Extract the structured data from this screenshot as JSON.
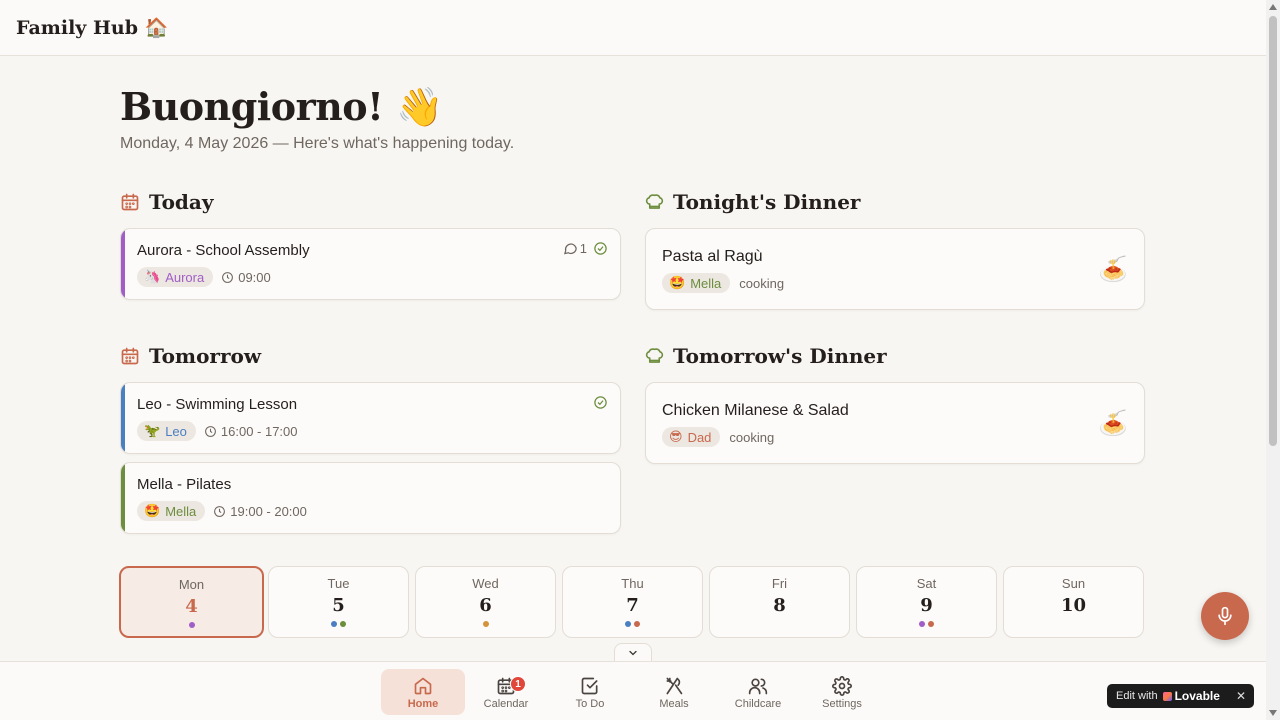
{
  "app": {
    "title": "Family Hub",
    "title_emoji": "🏠"
  },
  "greeting": {
    "text": "Buongiorno!",
    "emoji": "👋",
    "subtitle": "Monday, 4 May 2026 — Here's what's happening today."
  },
  "today": {
    "title": "Today",
    "events": [
      {
        "title": "Aurora - School Assembly",
        "person": "Aurora",
        "person_emoji": "🦄",
        "time": "09:00",
        "comments": "1",
        "color": "#a15ec6",
        "chip_color": "#a15ec6"
      }
    ]
  },
  "tomorrow": {
    "title": "Tomorrow",
    "events": [
      {
        "title": "Leo - Swimming Lesson",
        "person": "Leo",
        "person_emoji": "🦖",
        "time": "16:00 - 17:00",
        "color": "#4a7fc1",
        "chip_color": "#4a7fc1"
      },
      {
        "title": "Mella - Pilates",
        "person": "Mella",
        "person_emoji": "🤩",
        "time": "19:00 - 20:00",
        "color": "#6d8d3f",
        "chip_color": "#6d8d3f"
      }
    ]
  },
  "tonight_dinner": {
    "title": "Tonight's Dinner",
    "dish": "Pasta al Ragù",
    "cook": "Mella",
    "cook_emoji": "🤩",
    "role": "cooking",
    "dish_emoji": "🍝",
    "chip_color": "#6d8d3f"
  },
  "tomorrow_dinner": {
    "title": "Tomorrow's Dinner",
    "dish": "Chicken Milanese & Salad",
    "cook": "Dad",
    "cook_emoji": "😎",
    "role": "cooking",
    "dish_emoji": "🍝",
    "chip_color": "#c8694e"
  },
  "week": [
    {
      "name": "Mon",
      "num": "4",
      "dots": [
        "#a15ec6"
      ]
    },
    {
      "name": "Tue",
      "num": "5",
      "dots": [
        "#4a7fc1",
        "#6d8d3f"
      ]
    },
    {
      "name": "Wed",
      "num": "6",
      "dots": [
        "#d4933a"
      ]
    },
    {
      "name": "Thu",
      "num": "7",
      "dots": [
        "#4a7fc1",
        "#c8694e"
      ]
    },
    {
      "name": "Fri",
      "num": "8",
      "dots": []
    },
    {
      "name": "Sat",
      "num": "9",
      "dots": [
        "#a15ec6",
        "#c8694e"
      ]
    },
    {
      "name": "Sun",
      "num": "10",
      "dots": []
    }
  ],
  "nav": {
    "home": "Home",
    "calendar": "Calendar",
    "calendar_badge": "1",
    "todo": "To Do",
    "meals": "Meals",
    "childcare": "Childcare",
    "settings": "Settings"
  },
  "lovable": {
    "prefix": "Edit with",
    "name": "Lovable",
    "close": "✕"
  },
  "colors": {
    "accent": "#c8694e",
    "text": "#241f1c",
    "muted": "#6f6760",
    "background": "#f8f6f2"
  }
}
